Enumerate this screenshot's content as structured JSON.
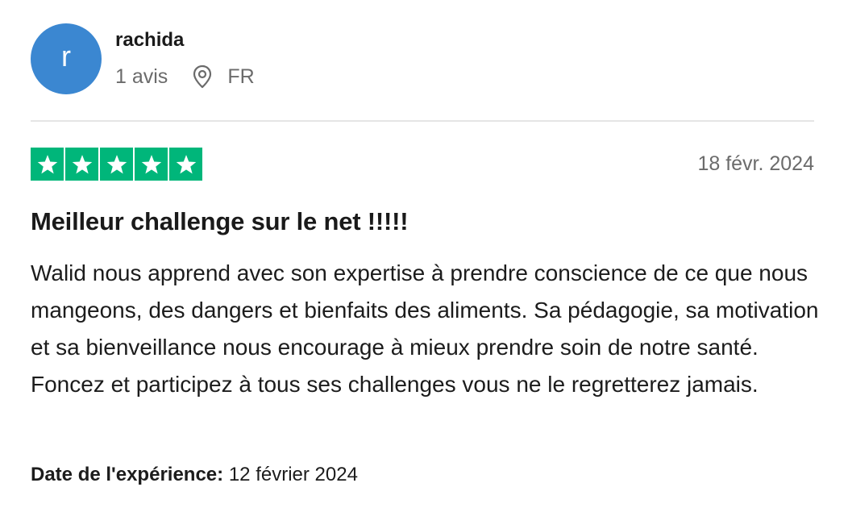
{
  "reviewer": {
    "initial": "r",
    "avatar_color": "#3b87d1",
    "name": "rachida",
    "review_count": "1 avis",
    "location_icon": "map-pin-icon",
    "country": "FR"
  },
  "review": {
    "rating": 5,
    "rating_max": 5,
    "star_color": "#00b67a",
    "date": "18 févr. 2024",
    "title": "Meilleur challenge sur le net !!!!!",
    "body": "Walid nous apprend avec son expertise à prendre conscience de ce que nous mangeons, des dangers et bienfaits des aliments. Sa pédagogie, sa motivation et sa bienveillance nous encourage à mieux prendre soin de notre santé. Foncez et participez à tous ses challenges vous ne le regretterez jamais.",
    "experience_label": "Date de l'expérience:",
    "experience_date": "12 février 2024"
  }
}
